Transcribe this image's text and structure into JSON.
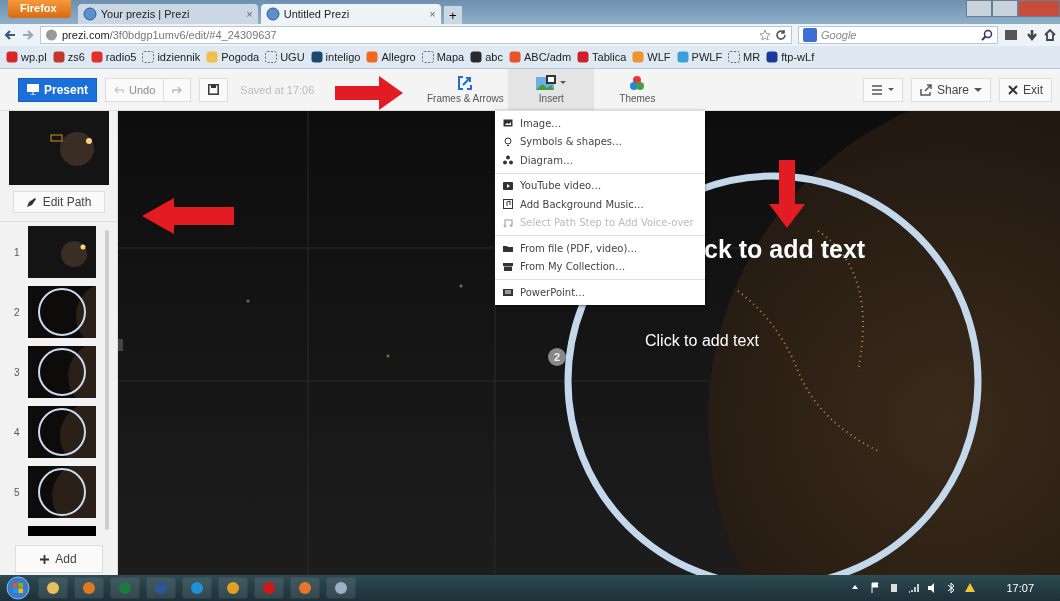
{
  "browser": {
    "menu_button": "Firefox",
    "tabs": [
      {
        "title": "Your prezis | Prezi",
        "close": "×",
        "selected": false
      },
      {
        "title": "Untitled Prezi",
        "close": "×",
        "selected": true
      }
    ],
    "new_tab": "+",
    "url": {
      "domain": "prezi.com",
      "path": "/3f0bdgp1umv6/edit/#4_24309637"
    },
    "search": {
      "placeholder": "Google"
    },
    "bookmarks": [
      {
        "label": "wp.pl",
        "kind": "favicon",
        "color": "#d9262b"
      },
      {
        "label": "zs6",
        "kind": "favicon",
        "color": "#c0392b"
      },
      {
        "label": "radio5",
        "kind": "favicon",
        "color": "#e0302a"
      },
      {
        "label": "idziennik",
        "kind": "blank"
      },
      {
        "label": "Pogoda",
        "kind": "favicon",
        "color": "#f0c04a"
      },
      {
        "label": "UGU",
        "kind": "blank"
      },
      {
        "label": "inteligo",
        "kind": "favicon",
        "color": "#1c4a6e"
      },
      {
        "label": "Allegro",
        "kind": "favicon",
        "color": "#f26b1d"
      },
      {
        "label": "Mapa",
        "kind": "blank"
      },
      {
        "label": "abc",
        "kind": "favicon",
        "color": "#2a2a2a"
      },
      {
        "label": "ABC/adm",
        "kind": "favicon",
        "color": "#e8532a"
      },
      {
        "label": "Tablica",
        "kind": "favicon",
        "color": "#d2202a"
      },
      {
        "label": "WLF",
        "kind": "favicon",
        "color": "#f0922e"
      },
      {
        "label": "PWLF",
        "kind": "favicon",
        "color": "#3aa0d8"
      },
      {
        "label": "MR",
        "kind": "blank"
      },
      {
        "label": "ftp-wLf",
        "kind": "favicon",
        "color": "#1a3a9a"
      }
    ]
  },
  "toolbar": {
    "present": "Present",
    "undo": "Undo",
    "saved": "Saved at 17:06",
    "tools": [
      {
        "label": "Frames & Arrows",
        "kind": "frames",
        "selected": false
      },
      {
        "label": "Insert",
        "kind": "insert",
        "selected": true
      },
      {
        "label": "Themes",
        "kind": "themes",
        "selected": false
      }
    ],
    "share": "Share",
    "exit": "Exit"
  },
  "sidebar": {
    "edit_path": "Edit Path",
    "steps": [
      {
        "number": "1",
        "kind": "overview"
      },
      {
        "number": "2",
        "kind": "circle"
      },
      {
        "number": "3",
        "kind": "circle"
      },
      {
        "number": "4",
        "kind": "circle"
      },
      {
        "number": "5",
        "kind": "circle"
      }
    ],
    "add": "Add"
  },
  "canvas": {
    "title": "ck to add text",
    "body": "Click to add text",
    "step_badge": "2"
  },
  "insert_menu": {
    "groups": [
      {
        "items": [
          {
            "label": "Image…",
            "kind": "image",
            "disabled": false
          },
          {
            "label": "Symbols & shapes…",
            "kind": "symbol",
            "disabled": false
          },
          {
            "label": "Diagram…",
            "kind": "diagram",
            "disabled": false
          }
        ]
      },
      {
        "items": [
          {
            "label": "YouTube video…",
            "kind": "video",
            "disabled": false
          },
          {
            "label": "Add Background Music…",
            "kind": "music",
            "disabled": false
          },
          {
            "label": "Select Path Step to Add Voice-over",
            "kind": "voice",
            "disabled": true
          }
        ]
      },
      {
        "items": [
          {
            "label": "From file (PDF, video)…",
            "kind": "file",
            "disabled": false
          },
          {
            "label": "From My Collection…",
            "kind": "collection",
            "disabled": false
          }
        ]
      },
      {
        "items": [
          {
            "label": "PowerPoint…",
            "kind": "powerpoint",
            "disabled": false
          }
        ]
      }
    ]
  },
  "taskbar": {
    "clock": "17:07"
  }
}
